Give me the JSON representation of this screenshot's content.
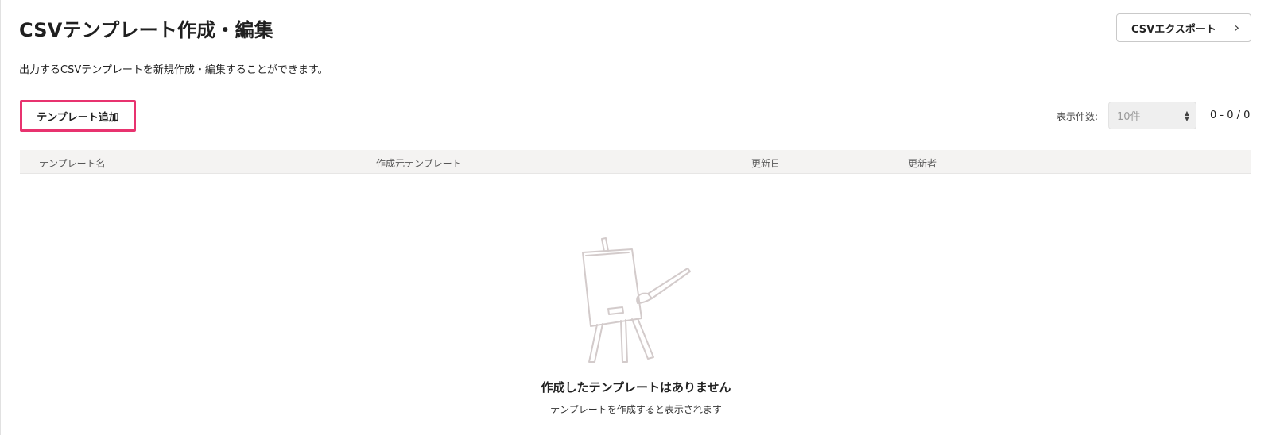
{
  "header": {
    "title": "CSVテンプレート作成・編集",
    "export_label": "CSVエクスポート",
    "export_icon": "chevron-right-icon"
  },
  "description": "出力するCSVテンプレートを新規作成・編集することができます。",
  "toolbar": {
    "add_template_label": "テンプレート追加",
    "add_template_highlight_color": "#e8336f",
    "per_page_label": "表示件数:",
    "per_page_value": "10件",
    "pagination_range": "0 - 0 / 0"
  },
  "table": {
    "columns": [
      "テンプレート名",
      "作成元テンプレート",
      "更新日",
      "更新者"
    ],
    "rows": []
  },
  "empty_state": {
    "icon": "easel-paintbrush-icon",
    "title": "作成したテンプレートはありません",
    "subtitle": "テンプレートを作成すると表示されます"
  }
}
